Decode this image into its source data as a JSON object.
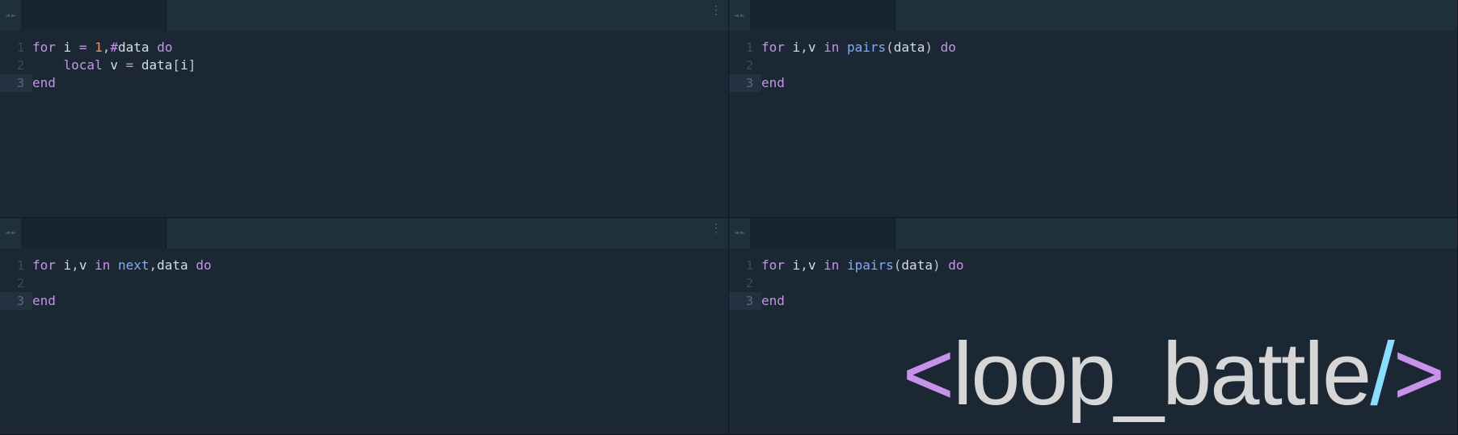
{
  "panes": [
    {
      "lines": [
        {
          "n": "1",
          "tokens": [
            [
              "kw",
              "for"
            ],
            [
              "plain",
              " i "
            ],
            [
              "op",
              "="
            ],
            [
              "plain",
              " "
            ],
            [
              "num",
              "1"
            ],
            [
              "punc",
              ","
            ],
            [
              "op",
              "#"
            ],
            [
              "id",
              "data"
            ],
            [
              "plain",
              " "
            ],
            [
              "kw",
              "do"
            ]
          ]
        },
        {
          "n": "2",
          "tokens": [
            [
              "plain",
              "    "
            ],
            [
              "kw",
              "local"
            ],
            [
              "plain",
              " v "
            ],
            [
              "op",
              "="
            ],
            [
              "plain",
              " data"
            ],
            [
              "punc",
              "["
            ],
            [
              "id",
              "i"
            ],
            [
              "punc",
              "]"
            ]
          ]
        },
        {
          "n": "3",
          "hl": true,
          "tokens": [
            [
              "kw",
              "end"
            ]
          ]
        }
      ]
    },
    {
      "lines": [
        {
          "n": "1",
          "tokens": [
            [
              "kw",
              "for"
            ],
            [
              "plain",
              " i"
            ],
            [
              "punc",
              ","
            ],
            [
              "plain",
              "v "
            ],
            [
              "kw",
              "in"
            ],
            [
              "plain",
              " "
            ],
            [
              "fn",
              "pairs"
            ],
            [
              "punc",
              "("
            ],
            [
              "id",
              "data"
            ],
            [
              "punc",
              ")"
            ],
            [
              "plain",
              " "
            ],
            [
              "kw",
              "do"
            ]
          ]
        },
        {
          "n": "2",
          "tokens": []
        },
        {
          "n": "3",
          "hl": true,
          "tokens": [
            [
              "kw",
              "end"
            ]
          ]
        }
      ]
    },
    {
      "lines": [
        {
          "n": "1",
          "tokens": [
            [
              "kw",
              "for"
            ],
            [
              "plain",
              " i"
            ],
            [
              "punc",
              ","
            ],
            [
              "plain",
              "v "
            ],
            [
              "kw",
              "in"
            ],
            [
              "plain",
              " "
            ],
            [
              "fn",
              "next"
            ],
            [
              "punc",
              ","
            ],
            [
              "id",
              "data"
            ],
            [
              "plain",
              " "
            ],
            [
              "kw",
              "do"
            ]
          ]
        },
        {
          "n": "2",
          "tokens": []
        },
        {
          "n": "3",
          "hl": true,
          "tokens": [
            [
              "kw",
              "end"
            ]
          ]
        }
      ]
    },
    {
      "lines": [
        {
          "n": "1",
          "tokens": [
            [
              "kw",
              "for"
            ],
            [
              "plain",
              " i"
            ],
            [
              "punc",
              ","
            ],
            [
              "plain",
              "v "
            ],
            [
              "kw",
              "in"
            ],
            [
              "plain",
              " "
            ],
            [
              "fn",
              "ipairs"
            ],
            [
              "punc",
              "("
            ],
            [
              "id",
              "data"
            ],
            [
              "punc",
              ")"
            ],
            [
              "plain",
              " "
            ],
            [
              "kw",
              "do"
            ]
          ]
        },
        {
          "n": "2",
          "tokens": []
        },
        {
          "n": "3",
          "hl": true,
          "tokens": [
            [
              "kw",
              "end"
            ]
          ]
        }
      ]
    }
  ],
  "watermark": {
    "open": "<",
    "text": "loop_battle",
    "slash": "/",
    "close": ">"
  },
  "nav": {
    "left": "◄",
    "right": "►"
  },
  "more": "⋮"
}
